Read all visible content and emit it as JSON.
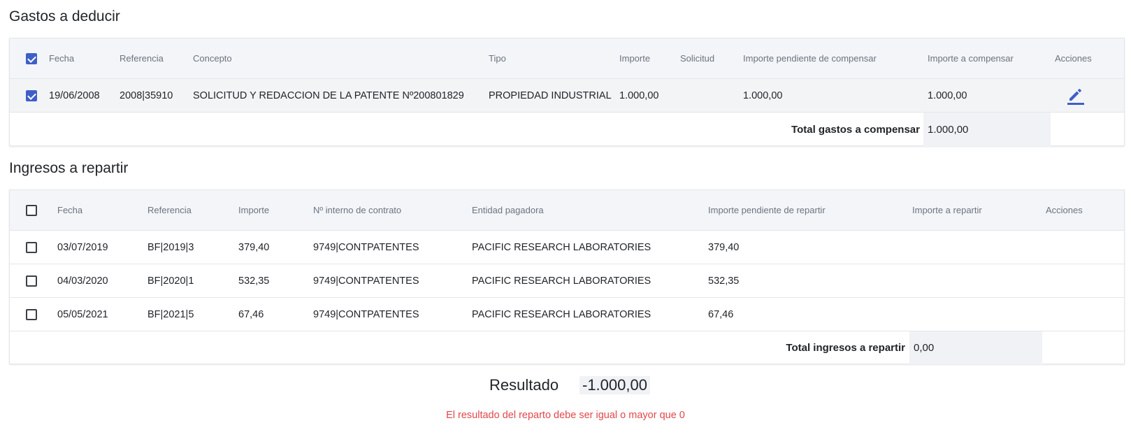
{
  "gastos": {
    "title": "Gastos a deducir",
    "headers": {
      "fecha": "Fecha",
      "referencia": "Referencia",
      "concepto": "Concepto",
      "tipo": "Tipo",
      "importe": "Importe",
      "solicitud": "Solicitud",
      "pendiente": "Importe pendiente de compensar",
      "compensar": "Importe a compensar",
      "acciones": "Acciones"
    },
    "select_all_checked": true,
    "rows": [
      {
        "checked": true,
        "fecha": "19/06/2008",
        "referencia": "2008|35910",
        "concepto": "SOLICITUD Y REDACCION DE LA PATENTE Nº200801829",
        "tipo": "PROPIEDAD INDUSTRIAL",
        "importe": "1.000,00",
        "solicitud": "",
        "pendiente": "1.000,00",
        "compensar": "1.000,00",
        "action_icon": "pencil-edit-icon"
      }
    ],
    "total_label": "Total gastos a compensar",
    "total_value": "1.000,00"
  },
  "ingresos": {
    "title": "Ingresos a repartir",
    "headers": {
      "fecha": "Fecha",
      "referencia": "Referencia",
      "importe": "Importe",
      "contrato": "Nº interno de contrato",
      "entidad": "Entidad pagadora",
      "pendiente": "Importe pendiente de repartir",
      "repartir": "Importe a repartir",
      "acciones": "Acciones"
    },
    "select_all_checked": false,
    "rows": [
      {
        "checked": false,
        "fecha": "03/07/2019",
        "referencia": "BF|2019|3",
        "importe": "379,40",
        "contrato": "9749|CONTPATENTES",
        "entidad": "PACIFIC RESEARCH LABORATORIES",
        "pendiente": "379,40",
        "repartir": ""
      },
      {
        "checked": false,
        "fecha": "04/03/2020",
        "referencia": "BF|2020|1",
        "importe": "532,35",
        "contrato": "9749|CONTPATENTES",
        "entidad": "PACIFIC RESEARCH LABORATORIES",
        "pendiente": "532,35",
        "repartir": ""
      },
      {
        "checked": false,
        "fecha": "05/05/2021",
        "referencia": "BF|2021|5",
        "importe": "67,46",
        "contrato": "9749|CONTPATENTES",
        "entidad": "PACIFIC RESEARCH LABORATORIES",
        "pendiente": "67,46",
        "repartir": ""
      }
    ],
    "total_label": "Total ingresos a repartir",
    "total_value": "0,00"
  },
  "resultado": {
    "label": "Resultado",
    "value": "-1.000,00",
    "error": "El resultado del reparto debe ser igual o mayor que 0"
  },
  "colors": {
    "accent": "#3f5fc8",
    "error": "#e0474c",
    "header_bg": "#f3f5f8"
  }
}
